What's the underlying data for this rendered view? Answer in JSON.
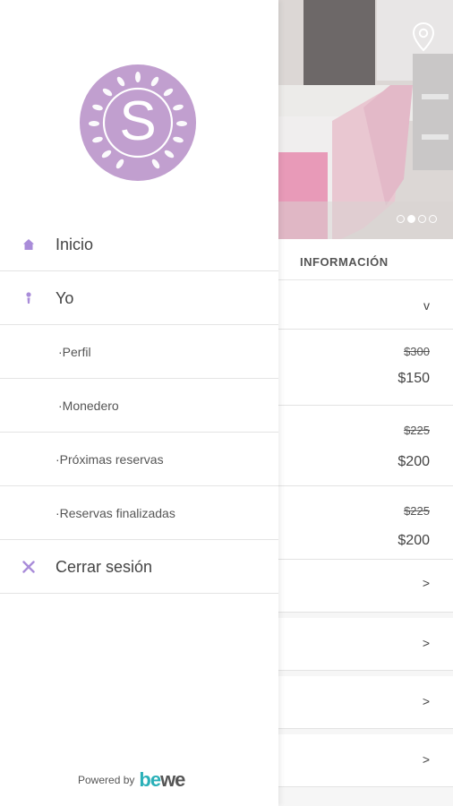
{
  "drawer": {
    "logo_letter": "S",
    "menu": [
      {
        "label": "Inicio",
        "icon": "home-icon"
      },
      {
        "label": "Yo",
        "icon": "person-icon"
      },
      {
        "label": "·Perfil"
      },
      {
        "label": "·Monedero"
      },
      {
        "label": "·Próximas reservas"
      },
      {
        "label": "·Reservas finalizadas"
      },
      {
        "label": "Cerrar sesión",
        "icon": "close-icon"
      }
    ],
    "footer": {
      "powered_by": "Powered by",
      "brand_be": "be",
      "brand_we": "we"
    }
  },
  "background": {
    "section_title": "INFORMACIÓN",
    "carousel": {
      "pages": 4,
      "active": 2
    },
    "rows": [
      {
        "chevron": "v"
      },
      {
        "old_price": "$300",
        "price": "$150"
      },
      {
        "old_price": "$225",
        "price": "$200"
      },
      {
        "old_price": "$225",
        "price": "$200"
      },
      {
        "chevron": ">"
      },
      {
        "chevron": ">"
      },
      {
        "chevron": ">"
      },
      {
        "chevron": ">"
      }
    ]
  },
  "colors": {
    "accent": "#a98cd9",
    "logo": "#c19fcf",
    "brand_teal": "#2ab0b8"
  }
}
